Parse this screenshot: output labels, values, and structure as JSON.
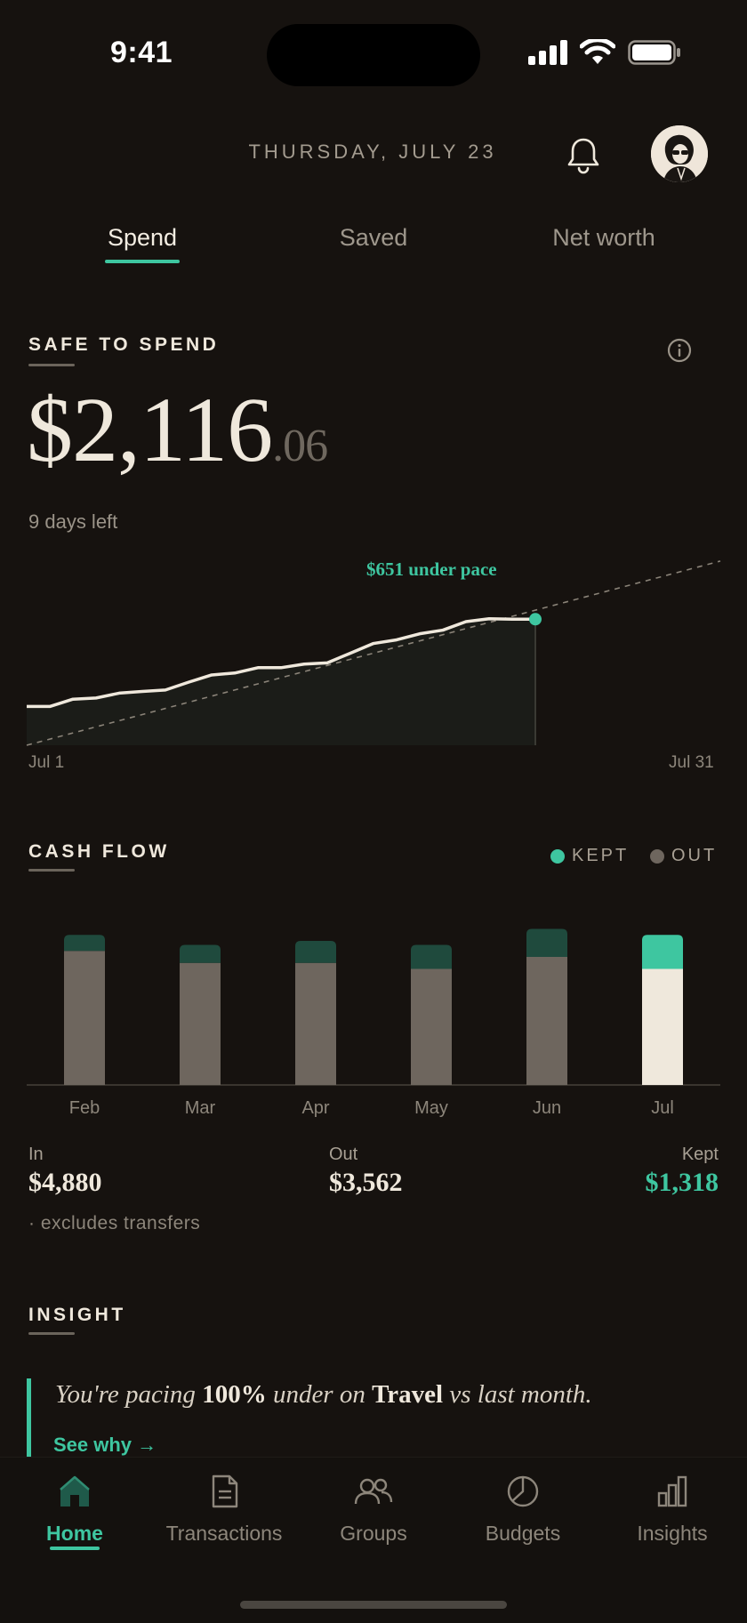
{
  "status_bar": {
    "time": "9:41"
  },
  "header": {
    "date": "THURSDAY, JULY 23",
    "bell_icon": "bell-icon",
    "avatar_icon": "avatar-portrait"
  },
  "tabs": [
    {
      "label": "Spend",
      "active": true
    },
    {
      "label": "Saved",
      "active": false
    },
    {
      "label": "Net worth",
      "active": false
    }
  ],
  "safe_to_spend": {
    "title": "SAFE TO SPEND",
    "amount_main": "$2,116",
    "amount_cents": ".06",
    "days_left": "9 days left",
    "pace_label": "$651 under pace",
    "x_start": "Jul 1",
    "x_end": "Jul 31"
  },
  "cash_flow": {
    "title": "CASH FLOW",
    "legend": [
      {
        "label": "KEPT",
        "color": "#3ec6a0"
      },
      {
        "label": "OUT",
        "color": "#6e665e"
      }
    ],
    "in_label": "In",
    "in_value": "$4,880",
    "out_label": "Out",
    "out_value": "$3,562",
    "kept_label": "Kept",
    "kept_value": "$1,318",
    "note": "· excludes transfers"
  },
  "insight": {
    "title": "INSIGHT",
    "text_1": "You're pacing ",
    "text_2": "100%",
    "text_3": " under on ",
    "text_4": "Travel",
    "text_5": " vs last month.",
    "link": "See why →"
  },
  "nav": [
    {
      "label": "Home",
      "icon": "home-icon",
      "active": true
    },
    {
      "label": "Transactions",
      "icon": "document-icon",
      "active": false
    },
    {
      "label": "Groups",
      "icon": "people-icon",
      "active": false
    },
    {
      "label": "Budgets",
      "icon": "pie-chart-icon",
      "active": false
    },
    {
      "label": "Insights",
      "icon": "bar-chart-icon",
      "active": false
    }
  ],
  "colors": {
    "accent": "#3ec6a0",
    "background": "#16120f",
    "out_bar": "#6e665e",
    "kept_bar_past": "#1f4a3d",
    "current_bar": "#efe8dc"
  },
  "chart_data": [
    {
      "type": "line",
      "x": [
        1,
        2,
        3,
        4,
        5,
        6,
        7,
        8,
        9,
        10,
        11,
        12,
        13,
        14,
        15,
        16,
        17,
        18,
        19,
        20,
        21,
        22,
        23
      ],
      "series": [
        {
          "values": [
            160,
            160,
            190,
            195,
            215,
            222,
            228,
            260,
            290,
            298,
            320,
            320,
            335,
            340,
            380,
            420,
            435,
            460,
            475,
            510,
            522,
            520,
            520
          ]
        }
      ],
      "pace_line": {
        "x": [
          1,
          31
        ],
        "values": [
          0,
          760
        ]
      },
      "x_tick_labels": [
        "Jul 1",
        "Jul 31"
      ],
      "annotation": "$651 under pace"
    },
    {
      "type": "bar",
      "categories": [
        "Feb",
        "Mar",
        "Apr",
        "May",
        "Jun",
        "Jul"
      ],
      "series": [
        {
          "name": "OUT",
          "values": [
            3350,
            3050,
            3050,
            2900,
            3200,
            2900
          ]
        },
        {
          "name": "KEPT",
          "values": [
            400,
            450,
            550,
            600,
            700,
            850
          ]
        }
      ]
    }
  ]
}
